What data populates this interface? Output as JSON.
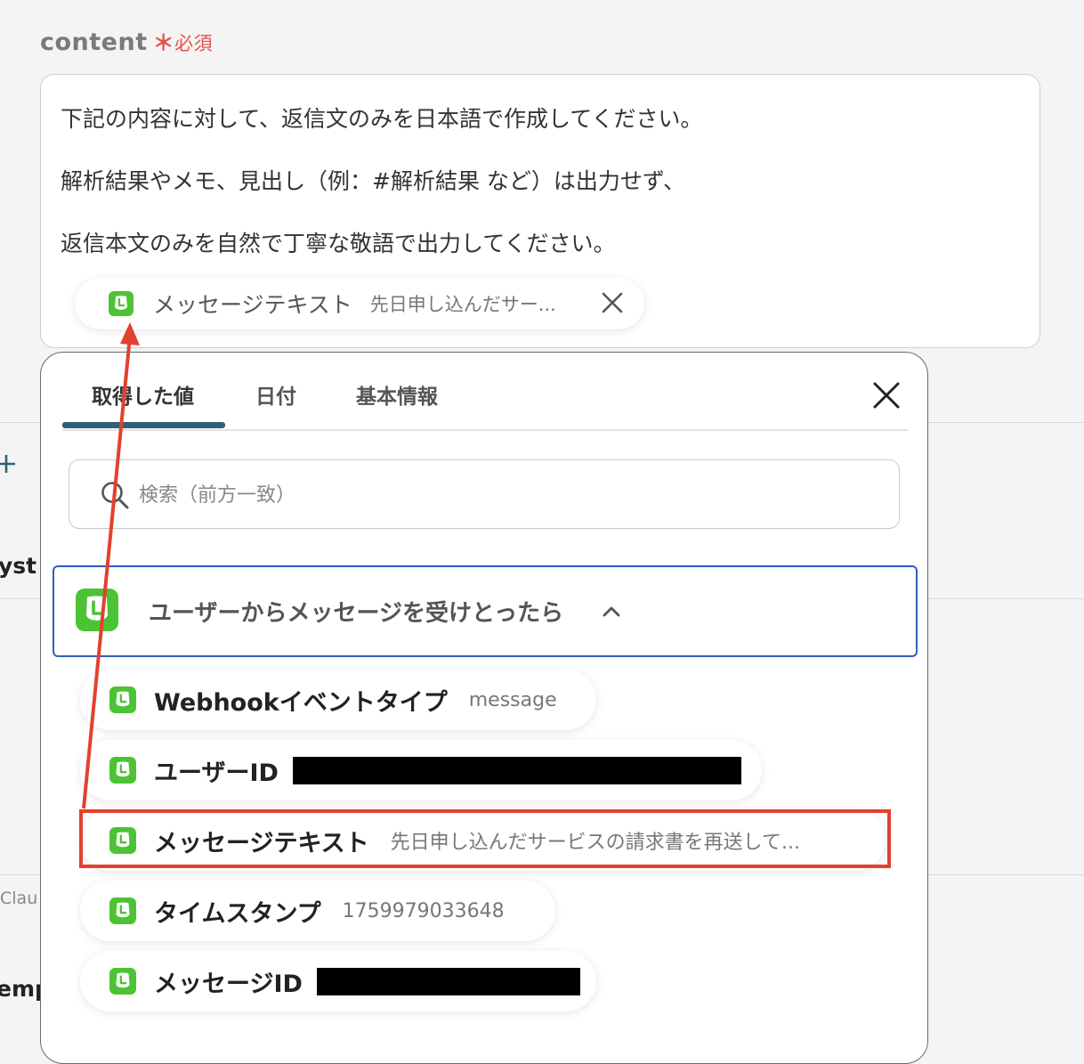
{
  "field": {
    "label": "content",
    "required_mark": "＊",
    "required_text": "必須",
    "text_lines": [
      "下記の内容に対して、返信文のみを日本語で作成してください。",
      "解析結果やメモ、見出し（例：#解析結果 など）は出力せず、",
      "返信本文のみを自然で丁寧な敬語で出力してください。"
    ],
    "variable": {
      "icon": "line-app-icon",
      "label": "メッセージテキスト",
      "value": "先日申し込んだサー..."
    }
  },
  "background": {
    "fragment_1": "yst",
    "fragment_2": "Clau",
    "fragment_3": "emp"
  },
  "popup": {
    "tabs": [
      "取得した値",
      "日付",
      "基本情報"
    ],
    "active_tab": 0,
    "search": {
      "placeholder": "検索（前方一致）",
      "value": ""
    },
    "trigger": {
      "label": "ユーザーからメッセージを受けとったら",
      "expanded": true
    },
    "items": [
      {
        "label": "Webhookイベントタイプ",
        "value": "message"
      },
      {
        "label": "ユーザーID",
        "value": ""
      },
      {
        "label": "メッセージテキスト",
        "value": "先日申し込んだサービスの請求書を再送して..."
      },
      {
        "label": "タイムスタンプ",
        "value": "1759979033648"
      },
      {
        "label": "メッセージID",
        "value": ""
      }
    ],
    "highlighted_item": 2
  },
  "colors": {
    "brand_green": "#4cc334",
    "accent_blue": "#2f5fb8",
    "annotation_red": "#e2412f",
    "required_red": "#e8504a",
    "tab_underline": "#2f6077"
  }
}
